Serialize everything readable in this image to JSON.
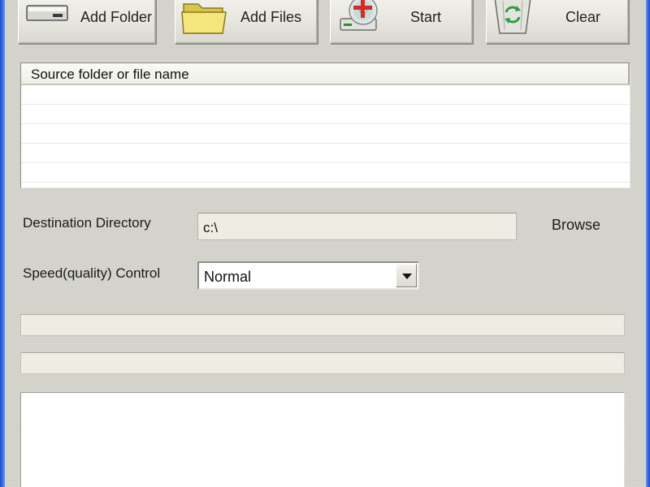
{
  "toolbar": {
    "add_folder_label": "Add Folder",
    "add_files_label": "Add Files",
    "start_label": "Start",
    "clear_label": "Clear"
  },
  "file_list": {
    "column_header": "Source folder or file name",
    "rows": [
      "",
      "",
      "",
      "",
      ""
    ]
  },
  "destination": {
    "label": "Destination Directory",
    "value": "c:\\",
    "browse_label": "Browse"
  },
  "speed": {
    "label": "Speed(quality) Control",
    "selected": "Normal"
  },
  "icons": {
    "add_folder": "drive-icon",
    "add_files": "folder-icon",
    "start": "cd-burn-icon",
    "clear": "recycle-bin-icon"
  },
  "colors": {
    "window_frame": "#3a74e6",
    "panel_bg": "#d4d3cc",
    "field_bg": "#eeede3",
    "folder_yellow": "#f2e07a",
    "plus_red": "#d42a2a",
    "recycle_green": "#2f9d3a"
  }
}
